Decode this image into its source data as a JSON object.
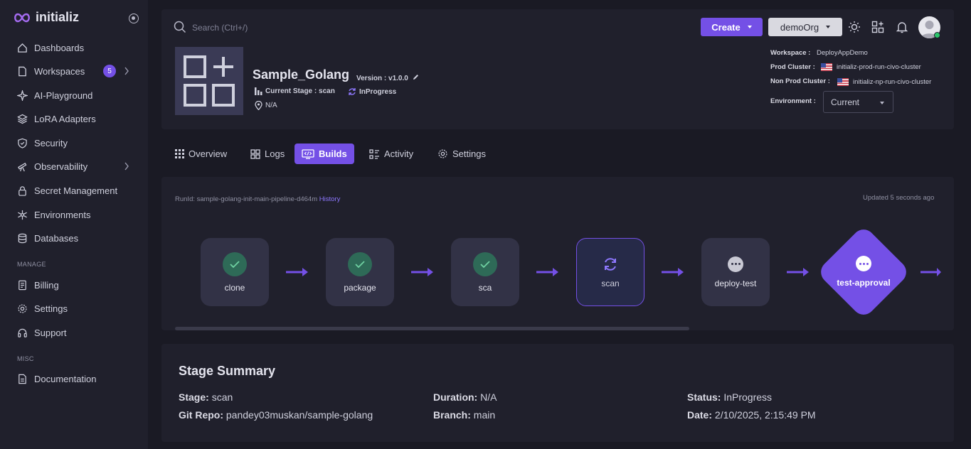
{
  "app": {
    "brand": "initializ"
  },
  "colors": {
    "accent": "#7450e6",
    "success": "#2e6a57",
    "background": "#1a1a24",
    "panel": "#20202c"
  },
  "sidebar": {
    "items": [
      {
        "label": "Dashboards",
        "icon": "dashboard-icon"
      },
      {
        "label": "Workspaces",
        "icon": "file-icon",
        "badge": "5",
        "expandable": true
      },
      {
        "label": "AI-Playground",
        "icon": "ai-icon"
      },
      {
        "label": "LoRA Adapters",
        "icon": "layers-icon"
      },
      {
        "label": "Security",
        "icon": "shield-icon"
      },
      {
        "label": "Observability",
        "icon": "telescope-icon",
        "expandable": true
      },
      {
        "label": "Secret Management",
        "icon": "lock-icon"
      },
      {
        "label": "Environments",
        "icon": "network-icon"
      },
      {
        "label": "Databases",
        "icon": "database-icon"
      }
    ],
    "manage_label": "MANAGE",
    "manage_items": [
      {
        "label": "Billing",
        "icon": "billing-icon"
      },
      {
        "label": "Settings",
        "icon": "gear-icon"
      },
      {
        "label": "Support",
        "icon": "headset-icon"
      }
    ],
    "misc_label": "MISC",
    "misc_items": [
      {
        "label": "Documentation",
        "icon": "document-icon"
      }
    ]
  },
  "header": {
    "search_placeholder": "Search (Ctrl+/)",
    "create_label": "Create",
    "org_label": "demoOrg"
  },
  "application": {
    "name": "Sample_Golang",
    "version": "Version : v1.0.0",
    "current_stage": "Current Stage : scan",
    "status": "InProgress",
    "location": "N/A",
    "workspace_label": "Workspace :",
    "workspace": "DeployAppDemo",
    "prod_cluster_label": "Prod Cluster :",
    "prod_cluster": "initializ-prod-run-civo-cluster",
    "nonprod_cluster_label": "Non Prod Cluster :",
    "nonprod_cluster": "initializ-np-run-civo-cluster",
    "environment_label": "Environment :",
    "environment": "Current"
  },
  "tabs": [
    {
      "label": "Overview",
      "icon": "grid-icon"
    },
    {
      "label": "Logs",
      "icon": "logs-icon"
    },
    {
      "label": "Builds",
      "icon": "builds-icon",
      "active": true
    },
    {
      "label": "Activity",
      "icon": "activity-icon"
    },
    {
      "label": "Settings",
      "icon": "gear-icon"
    }
  ],
  "pipeline": {
    "run_id_label": "RunId: sample-golang-init-main-pipeline-d464m",
    "history_link": "History",
    "updated": "Updated 5 seconds ago",
    "stages": [
      {
        "name": "clone",
        "status": "success"
      },
      {
        "name": "package",
        "status": "success"
      },
      {
        "name": "sca",
        "status": "success"
      },
      {
        "name": "scan",
        "status": "running"
      },
      {
        "name": "deploy-test",
        "status": "pending"
      },
      {
        "name": "test-approval",
        "status": "pending"
      }
    ]
  },
  "summary": {
    "title": "Stage Summary",
    "stage_label": "Stage:",
    "stage": "scan",
    "duration_label": "Duration:",
    "duration": "N/A",
    "status_label": "Status:",
    "status": "InProgress",
    "repo_label": "Git Repo:",
    "repo": "pandey03muskan/sample-golang",
    "branch_label": "Branch:",
    "branch": "main",
    "date_label": "Date:",
    "date": "2/10/2025, 2:15:49 PM"
  }
}
